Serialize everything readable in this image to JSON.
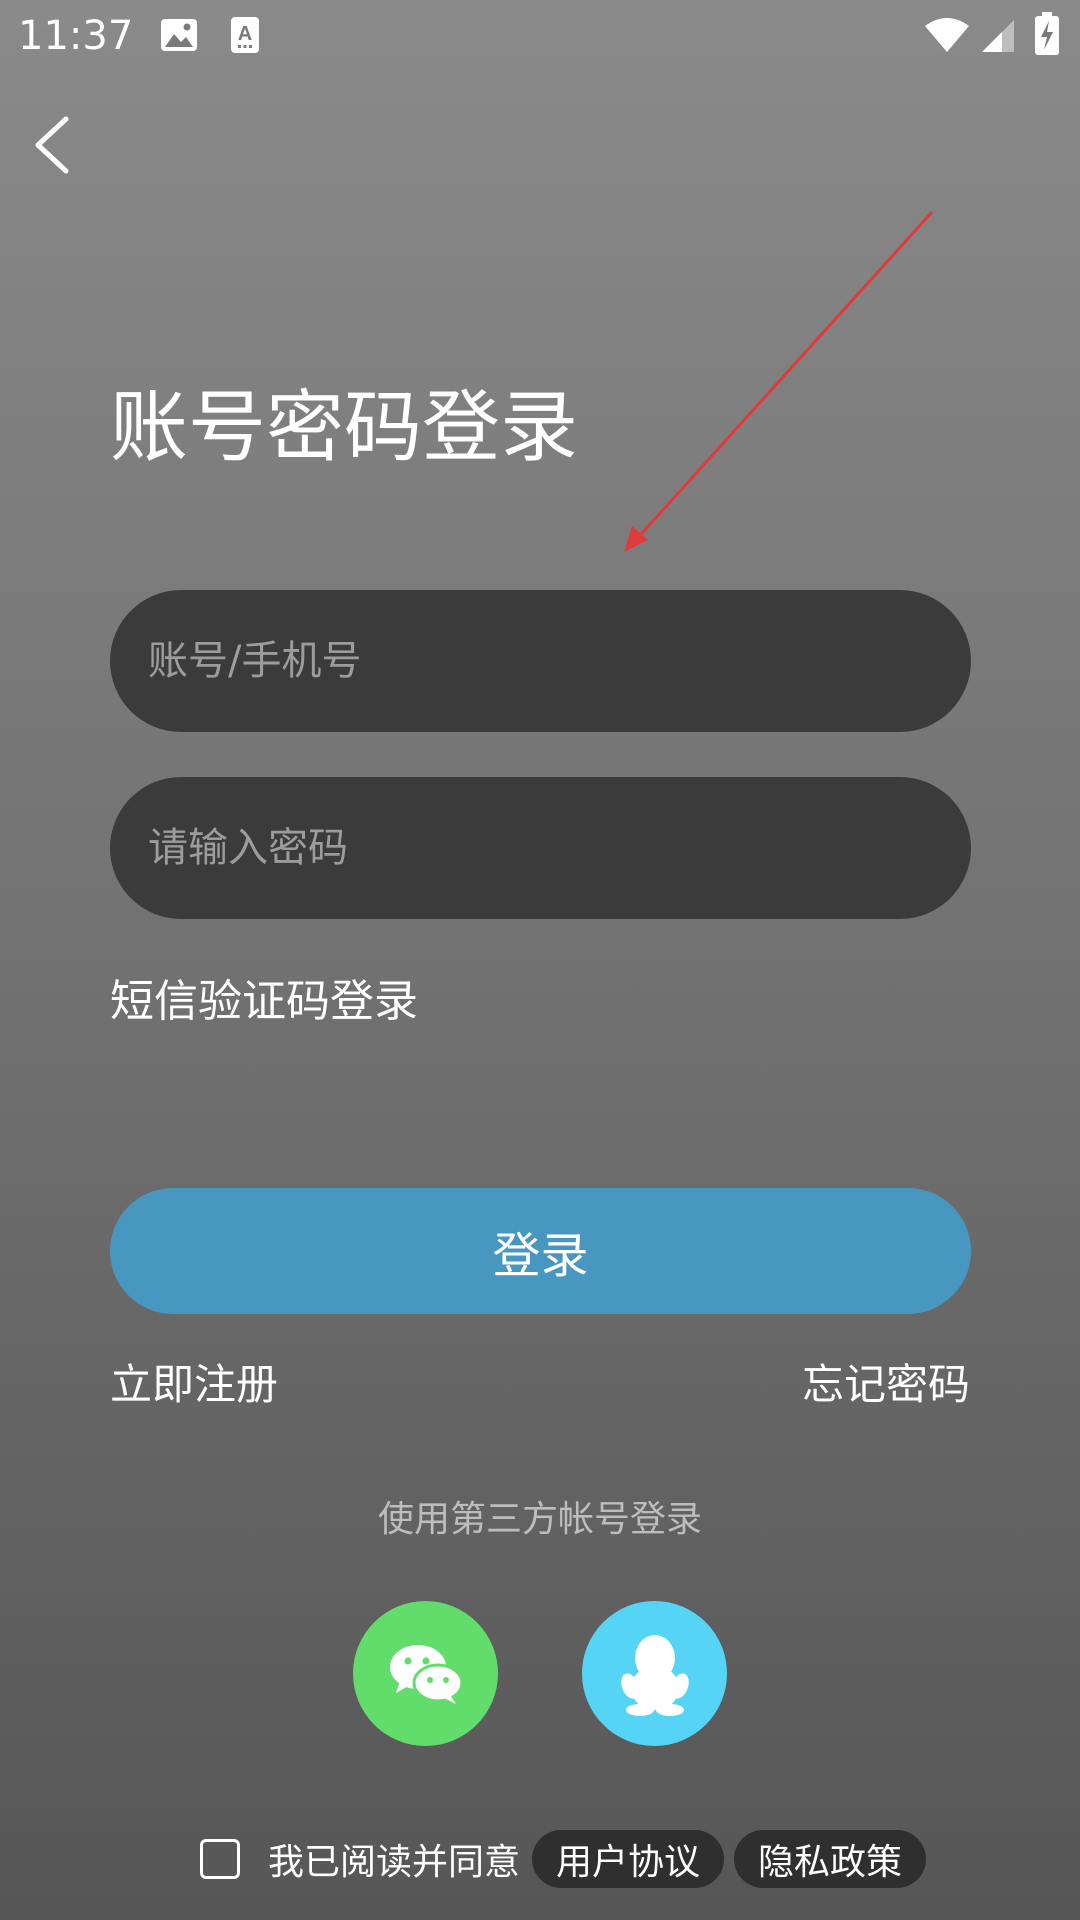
{
  "status_bar": {
    "time": "11:37",
    "icons": [
      "image-icon",
      "font-a-icon",
      "wifi-icon",
      "signal-icon",
      "battery-charging-icon"
    ]
  },
  "header": {
    "back_icon": "chevron-left-icon",
    "title": "账号密码登录"
  },
  "form": {
    "account_placeholder": "账号/手机号",
    "password_placeholder": "请输入密码",
    "sms_login_label": "短信验证码登录",
    "login_button_label": "登录",
    "register_label": "立即注册",
    "forgot_label": "忘记密码"
  },
  "third_party": {
    "label": "使用第三方帐号登录",
    "providers": [
      {
        "name": "wechat",
        "icon": "wechat-icon",
        "color": "#62dc6a"
      },
      {
        "name": "qq",
        "icon": "qq-penguin-icon",
        "color": "#56d4f5"
      }
    ]
  },
  "agreement": {
    "checked": false,
    "text": "我已阅读并同意",
    "user_agreement": "用户协议",
    "privacy_policy": "隐私政策"
  },
  "colors": {
    "accent": "#4897c0",
    "input_bg": "#3b3b3b",
    "annotation": "#e03a3a"
  }
}
